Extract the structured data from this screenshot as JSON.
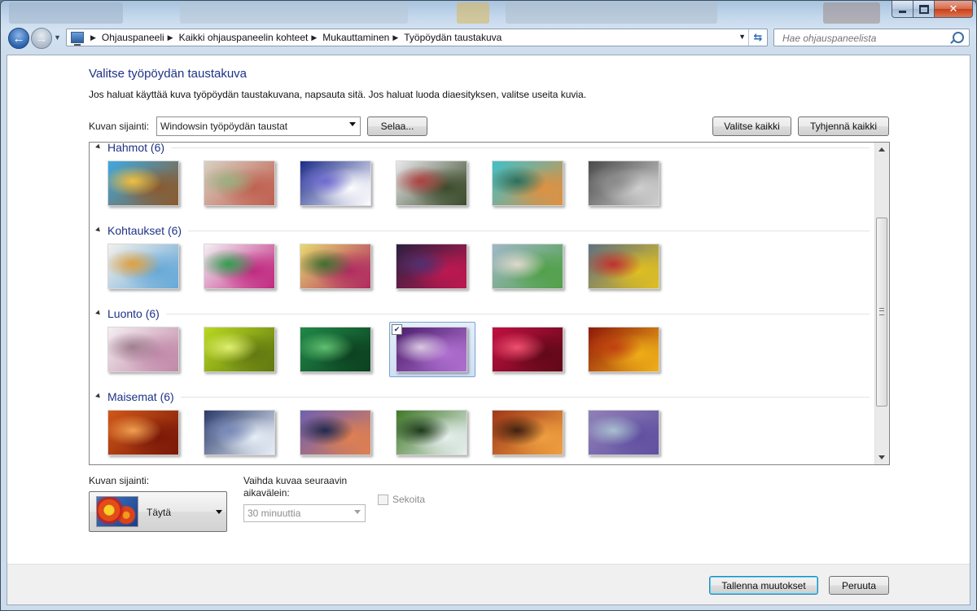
{
  "navigation": {
    "breadcrumbs": [
      "Ohjauspaneeli",
      "Kaikki ohjauspaneelin kohteet",
      "Mukauttaminen",
      "Työpöydän taustakuva"
    ],
    "search_placeholder": "Hae ohjauspaneelista"
  },
  "header": {
    "title": "Valitse työpöydän taustakuva",
    "description": "Jos haluat käyttää kuva työpöydän taustakuvana, napsauta sitä. Jos haluat luoda diaesityksen, valitse useita kuvia."
  },
  "location": {
    "label": "Kuvan sijainti:",
    "value": "Windowsin työpöydän taustat",
    "browse_label": "Selaa...",
    "select_all_label": "Valitse kaikki",
    "clear_all_label": "Tyhjennä kaikki"
  },
  "groups": [
    {
      "title": "Hahmot (6)",
      "selected_index": -1,
      "thumbs": [
        {
          "icon": "fantasy-island",
          "colors": [
            "#3fa9e0",
            "#8a5a2e",
            "#f0c040"
          ]
        },
        {
          "icon": "paper-characters",
          "colors": [
            "#d8d0c2",
            "#c06050",
            "#9ab080"
          ]
        },
        {
          "icon": "ghost-creature",
          "colors": [
            "#1c2c8a",
            "#ffffff",
            "#6f6ad0"
          ]
        },
        {
          "icon": "robot-characters",
          "colors": [
            "#e8e8ea",
            "#3a4a2a",
            "#b04040"
          ]
        },
        {
          "icon": "town-scene",
          "colors": [
            "#40c0c8",
            "#e09040",
            "#2a7060"
          ]
        },
        {
          "icon": "gray-figures",
          "colors": [
            "#4a4a4a",
            "#d0d0d0",
            "#8a8a8a"
          ]
        }
      ]
    },
    {
      "title": "Kohtaukset (6)",
      "selected_index": -1,
      "thumbs": [
        {
          "icon": "colorful-sketch",
          "colors": [
            "#f2f0ec",
            "#66a8d8",
            "#e0a040"
          ]
        },
        {
          "icon": "crystal-forest",
          "colors": [
            "#f4f0f4",
            "#c02880",
            "#30a050"
          ]
        },
        {
          "icon": "fantasy-land",
          "colors": [
            "#e8d870",
            "#b02a60",
            "#407030"
          ]
        },
        {
          "icon": "dark-balloons",
          "colors": [
            "#2c2040",
            "#c01850",
            "#503070"
          ]
        },
        {
          "icon": "flower-field",
          "colors": [
            "#a0b8c8",
            "#50a048",
            "#e0d8d0"
          ]
        },
        {
          "icon": "abstract-shapes",
          "colors": [
            "#607080",
            "#e0c020",
            "#c03030"
          ]
        }
      ]
    },
    {
      "title": "Luonto (6)",
      "selected_index": 3,
      "thumbs": [
        {
          "icon": "white-spikes",
          "colors": [
            "#f4eef0",
            "#c088a8",
            "#a08090"
          ]
        },
        {
          "icon": "green-succulent",
          "colors": [
            "#b8d820",
            "#607810",
            "#e0f070"
          ]
        },
        {
          "icon": "green-leaves",
          "colors": [
            "#208848",
            "#0c4020",
            "#60c070"
          ]
        },
        {
          "icon": "purple-thistle",
          "colors": [
            "#4c1e6e",
            "#b070d0",
            "#d8c8e0"
          ]
        },
        {
          "icon": "red-dahlia",
          "colors": [
            "#c01040",
            "#600818",
            "#f05070"
          ]
        },
        {
          "icon": "autumn-leaves",
          "colors": [
            "#901808",
            "#f0b018",
            "#c04010"
          ]
        }
      ]
    },
    {
      "title": "Maisemat (6)",
      "selected_index": -1,
      "thumbs": [
        {
          "icon": "red-canyon",
          "colors": [
            "#d05818",
            "#7a1808",
            "#f0a050"
          ]
        },
        {
          "icon": "ice-lake",
          "colors": [
            "#2a3a6a",
            "#e8f0f8",
            "#7888b8"
          ]
        },
        {
          "icon": "sunset-coast",
          "colors": [
            "#7060b0",
            "#e08050",
            "#202850"
          ]
        },
        {
          "icon": "waterfall",
          "colors": [
            "#407828",
            "#e8f0f0",
            "#1c3818"
          ]
        },
        {
          "icon": "rock-arch",
          "colors": [
            "#a03818",
            "#f0a040",
            "#402010"
          ]
        },
        {
          "icon": "lavender-field",
          "colors": [
            "#9080b8",
            "#6050a0",
            "#a8c0d0"
          ]
        }
      ]
    }
  ],
  "options": {
    "position_label": "Kuvan sijainti:",
    "position_value": "Täytä",
    "interval_label": "Vaihda kuvaa seuraavin aikavälein:",
    "interval_value": "30 minuuttia",
    "shuffle_label": "Sekoita",
    "shuffle_checked": false
  },
  "footer": {
    "save_label": "Tallenna muutokset",
    "cancel_label": "Peruuta"
  }
}
